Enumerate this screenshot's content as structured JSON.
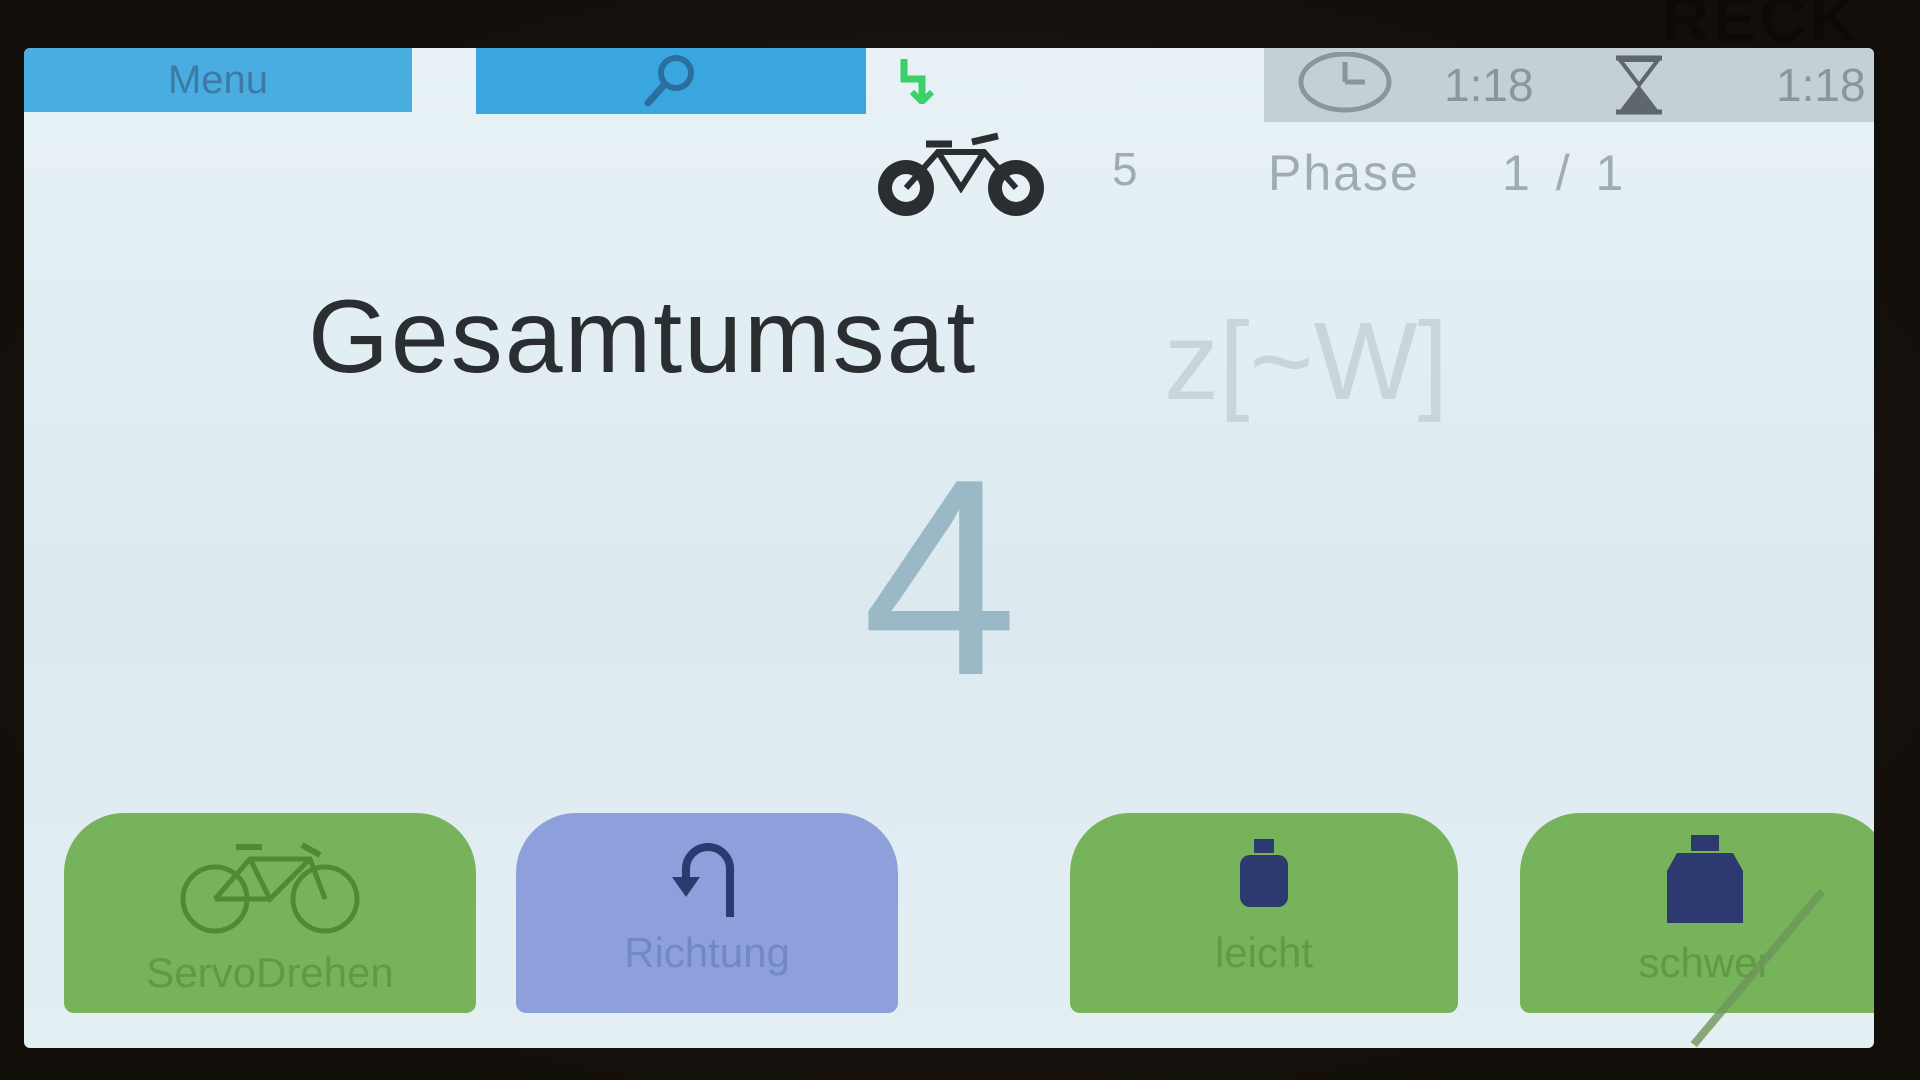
{
  "brand": {
    "text": "RECK"
  },
  "topbar": {
    "menu_label": "Menu",
    "search_icon": "magnifier-icon",
    "status_icon": "power-plug-icon",
    "clock_icon": "clock-icon",
    "elapsed_time": "1:18",
    "hourglass_icon": "hourglass-icon",
    "remaining_time": "1:18"
  },
  "status": {
    "bike_icon": "tandem-bike-icon",
    "bike_count": "5",
    "phase_label": "Phase",
    "phase_value": "1 / 1"
  },
  "main": {
    "title": "Gesamtumsat",
    "ghost_unit": "z[~W]",
    "value": "4"
  },
  "buttons": [
    {
      "label": "ServoDrehen",
      "icon": "bicycle-icon",
      "color": "#77b35a"
    },
    {
      "label": "Richtung",
      "icon": "u-turn-arrow-icon",
      "color": "#8ea0dc"
    },
    {
      "label": "leicht",
      "icon": "light-weight-icon",
      "color": "#77b35a"
    },
    {
      "label": "schwer",
      "icon": "heavy-weight-icon",
      "color": "#77b35a"
    }
  ],
  "colors": {
    "accent_blue": "#3aa6df",
    "button_green": "#77b35a",
    "button_blue": "#8ea0dc",
    "screen_bg": "#e8f2f6"
  }
}
